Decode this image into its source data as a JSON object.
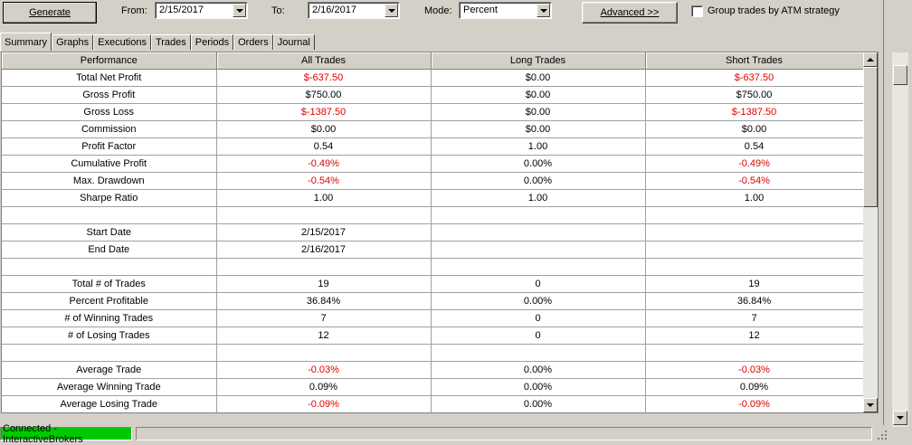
{
  "toolbar": {
    "generate_label": "Generate",
    "from_label": "From:",
    "from_value": "2/15/2017",
    "to_label": "To:",
    "to_value": "2/16/2017",
    "mode_label": "Mode:",
    "mode_value": "Percent",
    "advanced_label": "Advanced >>",
    "group_label": "Group trades by ATM strategy",
    "group_checked": false
  },
  "tabs": [
    {
      "label": "Summary",
      "active": true
    },
    {
      "label": "Graphs",
      "active": false
    },
    {
      "label": "Executions",
      "active": false
    },
    {
      "label": "Trades",
      "active": false
    },
    {
      "label": "Periods",
      "active": false
    },
    {
      "label": "Orders",
      "active": false
    },
    {
      "label": "Journal",
      "active": false
    }
  ],
  "grid": {
    "headers": [
      "Performance",
      "All Trades",
      "Long Trades",
      "Short Trades"
    ],
    "negative_color": "#e00000",
    "rows": [
      [
        "Total Net Profit",
        "$-637.50",
        "$0.00",
        "$-637.50"
      ],
      [
        "Gross Profit",
        "$750.00",
        "$0.00",
        "$750.00"
      ],
      [
        "Gross Loss",
        "$-1387.50",
        "$0.00",
        "$-1387.50"
      ],
      [
        "Commission",
        "$0.00",
        "$0.00",
        "$0.00"
      ],
      [
        "Profit Factor",
        "0.54",
        "1.00",
        "0.54"
      ],
      [
        "Cumulative Profit",
        "-0.49%",
        "0.00%",
        "-0.49%"
      ],
      [
        "Max. Drawdown",
        "-0.54%",
        "0.00%",
        "-0.54%"
      ],
      [
        "Sharpe Ratio",
        "1.00",
        "1.00",
        "1.00"
      ],
      [
        "",
        "",
        "",
        ""
      ],
      [
        "Start Date",
        "2/15/2017",
        "",
        ""
      ],
      [
        "End Date",
        "2/16/2017",
        "",
        ""
      ],
      [
        "",
        "",
        "",
        ""
      ],
      [
        "Total # of Trades",
        "19",
        "0",
        "19"
      ],
      [
        "Percent Profitable",
        "36.84%",
        "0.00%",
        "36.84%"
      ],
      [
        "# of Winning Trades",
        "7",
        "0",
        "7"
      ],
      [
        "# of Losing Trades",
        "12",
        "0",
        "12"
      ],
      [
        "",
        "",
        "",
        ""
      ],
      [
        "Average Trade",
        "-0.03%",
        "0.00%",
        "-0.03%"
      ],
      [
        "Average Winning Trade",
        "0.09%",
        "0.00%",
        "0.09%"
      ],
      [
        "Average Losing Trade",
        "-0.09%",
        "0.00%",
        "-0.09%"
      ]
    ]
  },
  "status": {
    "connection": "Connected - InteractiveBrokers",
    "connection_color": "#00c800"
  }
}
